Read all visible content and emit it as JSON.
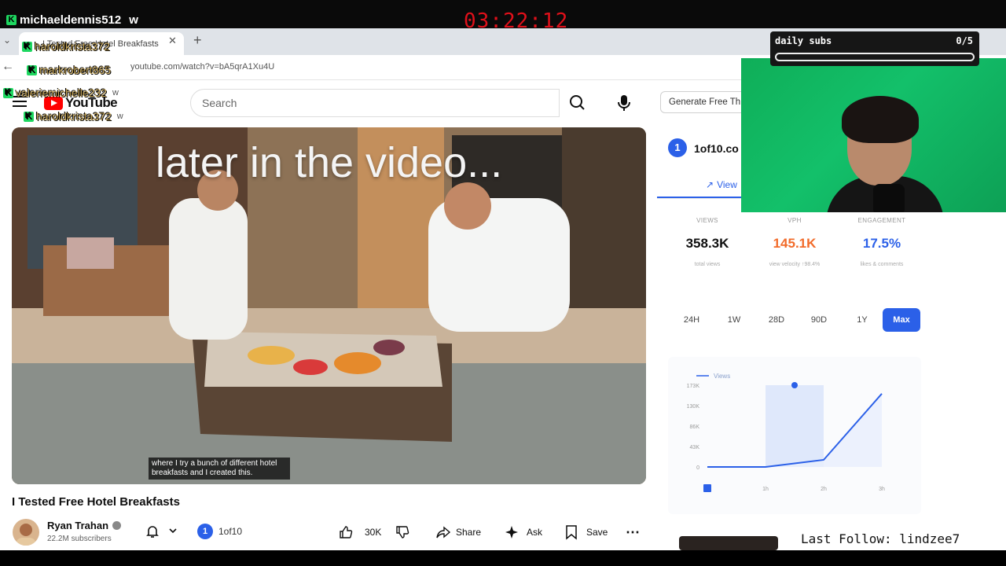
{
  "stream": {
    "timer": "03:22:12",
    "top_chat": {
      "user": "michaeldennis512",
      "suffix": "w"
    },
    "chat_overlay": [
      {
        "user": "haroldkrista372",
        "suffix": "w"
      },
      {
        "user": "markrobert865",
        "suffix": "w"
      },
      {
        "user": "valeriemichelle232",
        "suffix": "w"
      },
      {
        "user": "haroldkrista372",
        "suffix": "w"
      }
    ],
    "sub_goal": {
      "title": "daily subs",
      "count": "0/5",
      "progress": 0.0
    },
    "last_follow": "Last Follow: lindzee7"
  },
  "browser": {
    "tab_title": "I Tested Free Hotel Breakfasts",
    "url": "youtube.com/watch?v=bA5qrA1Xu4U",
    "new_tab_icon": "plus-icon"
  },
  "youtube": {
    "logo_text": "YouTube",
    "search_placeholder": "Search",
    "generate_button": "Generate Free Thu",
    "video": {
      "overlay_text": "later in the video...",
      "subtitle": "where I try a bunch of different hotel breakfasts and I created this.",
      "title": "I Tested Free Hotel Breakfasts"
    },
    "channel": {
      "name": "Ryan Trahan",
      "subscribers": "22.2M subscribers"
    },
    "extension_badge": {
      "number": "1",
      "label": "1of10"
    },
    "actions": {
      "like_count": "30K",
      "share": "Share",
      "ask": "Ask",
      "save": "Save"
    }
  },
  "side_panel": {
    "logo_number": "1",
    "logo_text": "1of10.co",
    "tab_label": "View",
    "stats": [
      {
        "label": "VIEWS",
        "value": "358.3K",
        "sub": "total views",
        "color": "#0f0f0f"
      },
      {
        "label": "VPH",
        "value": "145.1K",
        "sub": "view velocity ↑98.4%",
        "color": "#f26b2a"
      },
      {
        "label": "ENGAGEMENT",
        "value": "17.5%",
        "sub": "likes & comments",
        "color": "#2b60e8"
      }
    ],
    "ranges": [
      "24H",
      "1W",
      "28D",
      "90D",
      "1Y",
      "Max"
    ],
    "active_range": "Max"
  },
  "chart_data": {
    "type": "line",
    "legend": "Views",
    "x": [
      0,
      1,
      2,
      3
    ],
    "x_tick_labels": [
      "0",
      "1h",
      "2h",
      "3h"
    ],
    "y_tick_labels": [
      "0",
      "43K",
      "86K",
      "130K",
      "173K"
    ],
    "ylim": [
      0,
      173000
    ],
    "series": [
      {
        "name": "Views",
        "values": [
          0,
          0,
          15000,
          155000
        ]
      }
    ],
    "color": "#2b60e8",
    "highlight_range": [
      1,
      2
    ]
  }
}
